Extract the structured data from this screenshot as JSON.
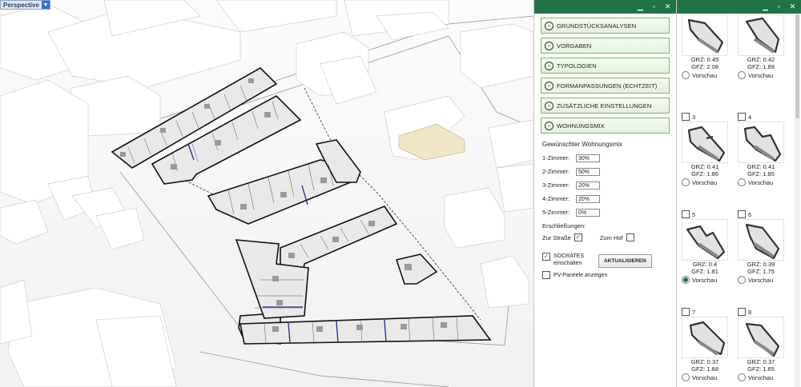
{
  "viewport": {
    "label": "Perspective"
  },
  "panel1": {
    "sections": [
      "GRUNDSTÜCKSANALYSEN",
      "VORGABEN",
      "TYPOLOGIEN",
      "FORMANPASSUNGEN (ECHTZEIT)",
      "ZUSÄTZLICHE EINSTELLUNGEN",
      "WOHNUNGSMIX"
    ],
    "mix_title": "Gewünschter Wohnungsmix",
    "mix": [
      {
        "label": "1-Zimmer:",
        "value": "30%"
      },
      {
        "label": "2-Zimmer:",
        "value": "50%"
      },
      {
        "label": "3-Zimmer:",
        "value": "20%"
      },
      {
        "label": "4-Zimmer:",
        "value": "20%"
      },
      {
        "label": "5-Zimmer:",
        "value": "0%"
      }
    ],
    "erschliessung_title": "Erschließungen:",
    "zur_strasse": "Zur Straße",
    "zum_hof": "Zum Hof",
    "socrates_line1": "SOCRATES",
    "socrates_line2": "einschalten",
    "update_button": "AKTUALISIEREN",
    "pv_label": "PV-Paneele anzeigen"
  },
  "panel2": {
    "preview_label": "Vorschau",
    "cards": [
      {
        "num": "",
        "grz": "GRZ: 0.45",
        "gfz": "GFZ: 2.08",
        "selected": false
      },
      {
        "num": "",
        "grz": "GRZ: 0.42",
        "gfz": "GFZ: 1.89",
        "selected": false
      },
      {
        "num": "3",
        "grz": "GRZ: 0.41",
        "gfz": "GFZ: 1.86",
        "selected": false
      },
      {
        "num": "4",
        "grz": "GRZ: 0.41",
        "gfz": "GFZ: 1.85",
        "selected": false
      },
      {
        "num": "5",
        "grz": "GRZ: 0.4",
        "gfz": "GFZ: 1.81",
        "selected": true
      },
      {
        "num": "6",
        "grz": "GRZ: 0.39",
        "gfz": "GFZ: 1.75",
        "selected": false
      },
      {
        "num": "7",
        "grz": "GRZ: 0.37",
        "gfz": "GFZ: 1.68",
        "selected": false
      },
      {
        "num": "8",
        "grz": "GRZ: 0.37",
        "gfz": "GFZ: 1.65",
        "selected": false
      }
    ]
  },
  "colors": {
    "accent": "#217346",
    "accordion_border": "#82b86a"
  },
  "icons": [
    "chevron-down-icon",
    "minimize-icon",
    "restore-icon",
    "close-icon",
    "checkmark-icon"
  ]
}
